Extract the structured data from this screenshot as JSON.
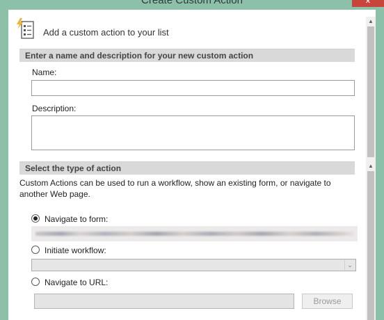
{
  "window": {
    "title": "Create Custom Action",
    "close_glyph": "✕"
  },
  "header": {
    "text": "Add a custom action to your list",
    "icon": "custom-action-list-icon"
  },
  "section_name": {
    "title": "Enter a name and description for your new custom action",
    "name_label": "Name:",
    "name_value": "",
    "description_label": "Description:",
    "description_value": ""
  },
  "section_type": {
    "title": "Select the type of action",
    "description": "Custom Actions can be used to run a workflow, show an existing form, or navigate to another Web page.",
    "options": [
      {
        "label": "Navigate to form:",
        "selected": true
      },
      {
        "label": "Initiate workflow:",
        "selected": false
      },
      {
        "label": "Navigate to URL:",
        "selected": false
      }
    ],
    "url_value": "",
    "browse_label": "Browse"
  },
  "scrollbar": {
    "up_glyph": "▲",
    "down_glyph": "▼",
    "dropdown_glyph": "⌄"
  }
}
